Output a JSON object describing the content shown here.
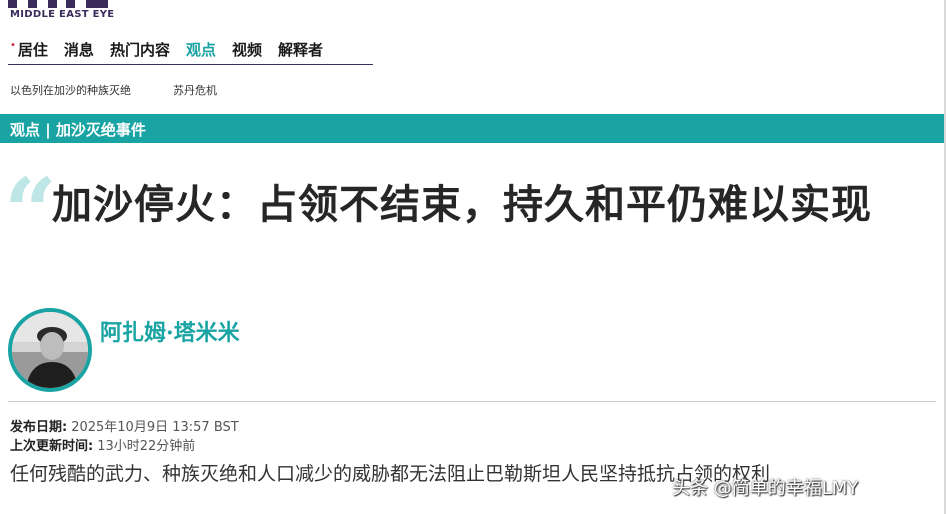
{
  "brand": {
    "name": "MIDDLE EAST EYE"
  },
  "nav": {
    "items": [
      {
        "label": "居住"
      },
      {
        "label": "消息"
      },
      {
        "label": "热门内容"
      },
      {
        "label": "观点"
      },
      {
        "label": "视频"
      },
      {
        "label": "解释者"
      }
    ],
    "active_index": 3
  },
  "subnav": {
    "items": [
      {
        "label": "以色列在加沙的种族灭绝"
      },
      {
        "label": "苏丹危机"
      }
    ]
  },
  "section_band": {
    "label": "观点 | 加沙灭绝事件"
  },
  "article": {
    "quote_mark": "“",
    "headline": "加沙停火：占领不结束，持久和平仍难以实现",
    "author": "阿扎姆·塔米米",
    "published_label": "发布日期:",
    "published_value": "2025年10月9日 13:57 BST",
    "updated_label": "上次更新时间:",
    "updated_value": "13小时22分钟前",
    "lede": "任何残酷的武力、种族灭绝和人口减少的威胁都无法阻止巴勒斯坦人民坚持抵抗占领的权利"
  },
  "watermark": {
    "text": "头条 @简单的幸福LMY"
  },
  "colors": {
    "accent": "#19a3a3",
    "brand": "#3a2d5c",
    "active_dot": "#d0203a"
  }
}
